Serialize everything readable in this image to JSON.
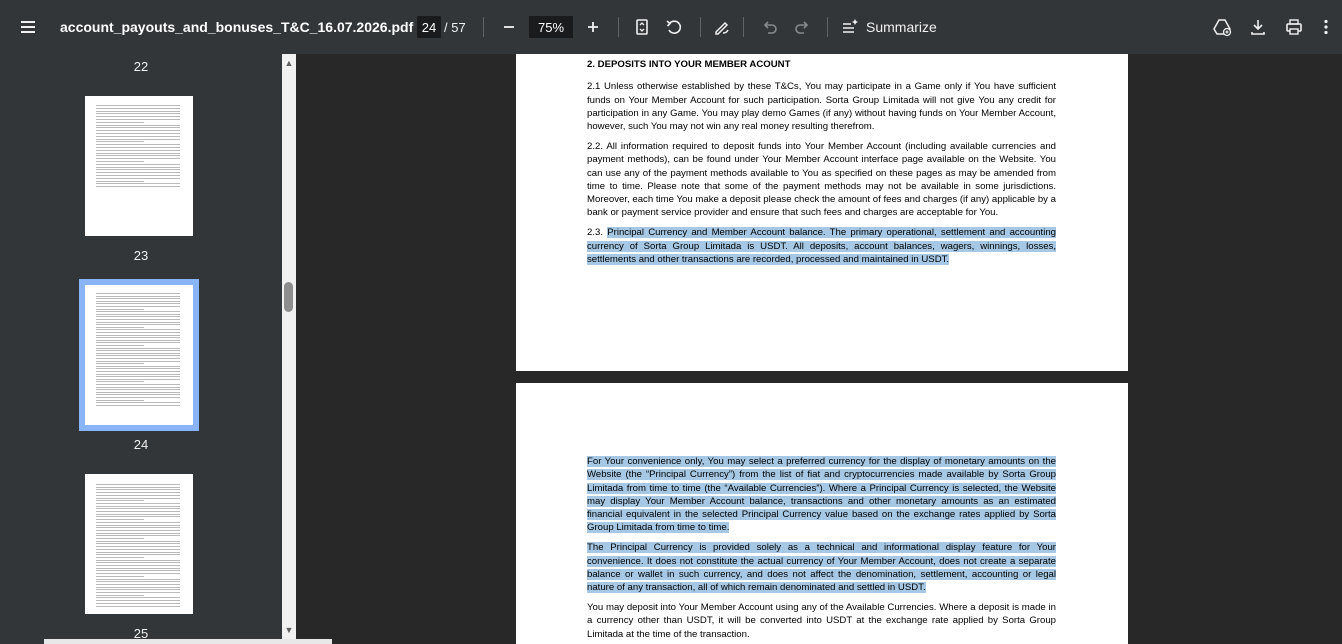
{
  "toolbar": {
    "file_name": "account_payouts_and_bonuses_T&C_16.07.2026.pdf",
    "current_page": "24",
    "page_total": "/ 57",
    "zoom": "75%",
    "summarize_label": "Summarize"
  },
  "sidebar": {
    "thumbnails": [
      {
        "label": "22"
      },
      {
        "label": "23"
      },
      {
        "label": "24",
        "selected": true
      },
      {
        "label": "25"
      }
    ]
  },
  "document": {
    "page1": {
      "heading": "2. DEPOSITS INTO YOUR MEMBER ACOUNT",
      "p1": "2.1 Unless otherwise established by these T&Cs, You may participate in a Game only if You have sufficient funds on Your Member Account for such participation. Sorta Group Limitada will not give You any credit for participation in any Game. You may play demo Games (if any) without having funds on Your Member Account, however, such You may not win any real money resulting therefrom.",
      "p2": "2.2. All information required to deposit funds into Your Member Account (including available currencies and payment methods), can be found under Your Member Account interface page available on the Website. You can use any of the payment methods available to You as specified on these pages as may be amended from time to time. Please note that some of the payment methods may not be available in some jurisdictions. Moreover, each time You make a deposit please check the amount of fees and charges (if any) applicable by a bank or payment service provider and ensure that such fees and charges are acceptable for You.",
      "p3_prefix": "2.3. ",
      "p3_highlight": "Principal Currency and Member Account balance. The primary operational, settlement and accounting currency of Sorta Group Limitada is USDT. All deposits, account balances, wagers, winnings, losses, settlements and other transactions are recorded, processed and maintained in USDT."
    },
    "page2": {
      "p1": "For Your convenience only, You may select a preferred currency for the display of monetary amounts on the Website (the “Principal Currency”) from the list of fiat and cryptocurrencies made available by Sorta Group Limitada from time to time (the “Available Currencies”). Where a Principal Currency is selected, the Website may display Your Member Account balance, transactions and other monetary amounts as an estimated financial equivalent in the selected Principal Currency value based on the exchange rates applied by Sorta Group Limitada from time to time.",
      "p2": "The Principal Currency is provided solely as a technical and informational display feature for Your convenience. It does not constitute the actual currency of Your Member Account, does not create a separate balance or wallet in such currency, and does not affect the denomination, settlement, accounting or legal nature of any transaction, all of which remain denominated and settled in USDT.",
      "p3": "You may deposit into Your Member Account using any of the Available Currencies. Where a deposit is made in a currency other than USDT, it will be converted into USDT at the exchange rate applied by Sorta Group Limitada at the time of the transaction."
    }
  }
}
